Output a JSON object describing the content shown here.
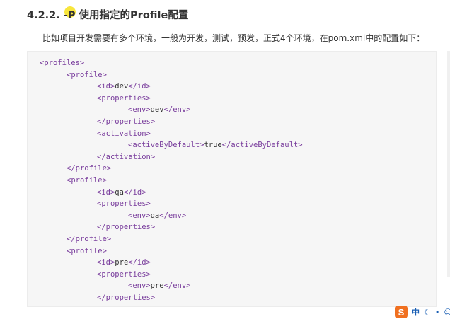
{
  "heading": {
    "number": "4.2.2.",
    "text": "-P 使用指定的Profile配置"
  },
  "intro": "比如项目开发需要有多个环境，一般为开发，测试，预发，正式4个环境，在pom.xml中的配置如下：",
  "code_lines": [
    {
      "indent": 0,
      "parts": [
        [
          "t",
          "<profiles>"
        ]
      ]
    },
    {
      "indent": 1,
      "parts": [
        [
          "t",
          "<profile>"
        ]
      ]
    },
    {
      "indent": 2,
      "parts": [
        [
          "t",
          "<id>"
        ],
        [
          "x",
          "dev"
        ],
        [
          "t",
          "</id>"
        ]
      ]
    },
    {
      "indent": 2,
      "parts": [
        [
          "t",
          "<properties>"
        ]
      ]
    },
    {
      "indent": 3,
      "parts": [
        [
          "t",
          "<env>"
        ],
        [
          "x",
          "dev"
        ],
        [
          "t",
          "</env>"
        ]
      ]
    },
    {
      "indent": 2,
      "parts": [
        [
          "t",
          "</properties>"
        ]
      ]
    },
    {
      "indent": 2,
      "parts": [
        [
          "t",
          "<activation>"
        ]
      ]
    },
    {
      "indent": 3,
      "parts": [
        [
          "t",
          "<activeByDefault>"
        ],
        [
          "x",
          "true"
        ],
        [
          "t",
          "</activeByDefault>"
        ]
      ]
    },
    {
      "indent": 2,
      "parts": [
        [
          "t",
          "</activation>"
        ]
      ]
    },
    {
      "indent": 1,
      "parts": [
        [
          "t",
          "</profile>"
        ]
      ]
    },
    {
      "indent": 1,
      "parts": [
        [
          "t",
          "<profile>"
        ]
      ]
    },
    {
      "indent": 2,
      "parts": [
        [
          "t",
          "<id>"
        ],
        [
          "x",
          "qa"
        ],
        [
          "t",
          "</id>"
        ]
      ]
    },
    {
      "indent": 2,
      "parts": [
        [
          "t",
          "<properties>"
        ]
      ]
    },
    {
      "indent": 3,
      "parts": [
        [
          "t",
          "<env>"
        ],
        [
          "x",
          "qa"
        ],
        [
          "t",
          "</env>"
        ]
      ]
    },
    {
      "indent": 2,
      "parts": [
        [
          "t",
          "</properties>"
        ]
      ]
    },
    {
      "indent": 1,
      "parts": [
        [
          "t",
          "</profile>"
        ]
      ]
    },
    {
      "indent": 1,
      "parts": [
        [
          "t",
          "<profile>"
        ]
      ]
    },
    {
      "indent": 2,
      "parts": [
        [
          "t",
          "<id>"
        ],
        [
          "x",
          "pre"
        ],
        [
          "t",
          "</id>"
        ]
      ]
    },
    {
      "indent": 2,
      "parts": [
        [
          "t",
          "<properties>"
        ]
      ]
    },
    {
      "indent": 3,
      "parts": [
        [
          "t",
          "<env>"
        ],
        [
          "x",
          "pre"
        ],
        [
          "t",
          "</env>"
        ]
      ]
    },
    {
      "indent": 2,
      "parts": [
        [
          "t",
          "</properties>"
        ]
      ]
    }
  ],
  "colors": {
    "tag": "#7a3e9d",
    "text": "#333333",
    "code_bg": "#f6f6f6"
  },
  "ime": {
    "logo": "S",
    "mode": "中",
    "icons": [
      "moon-icon",
      "dot-icon",
      "smile-icon"
    ]
  }
}
